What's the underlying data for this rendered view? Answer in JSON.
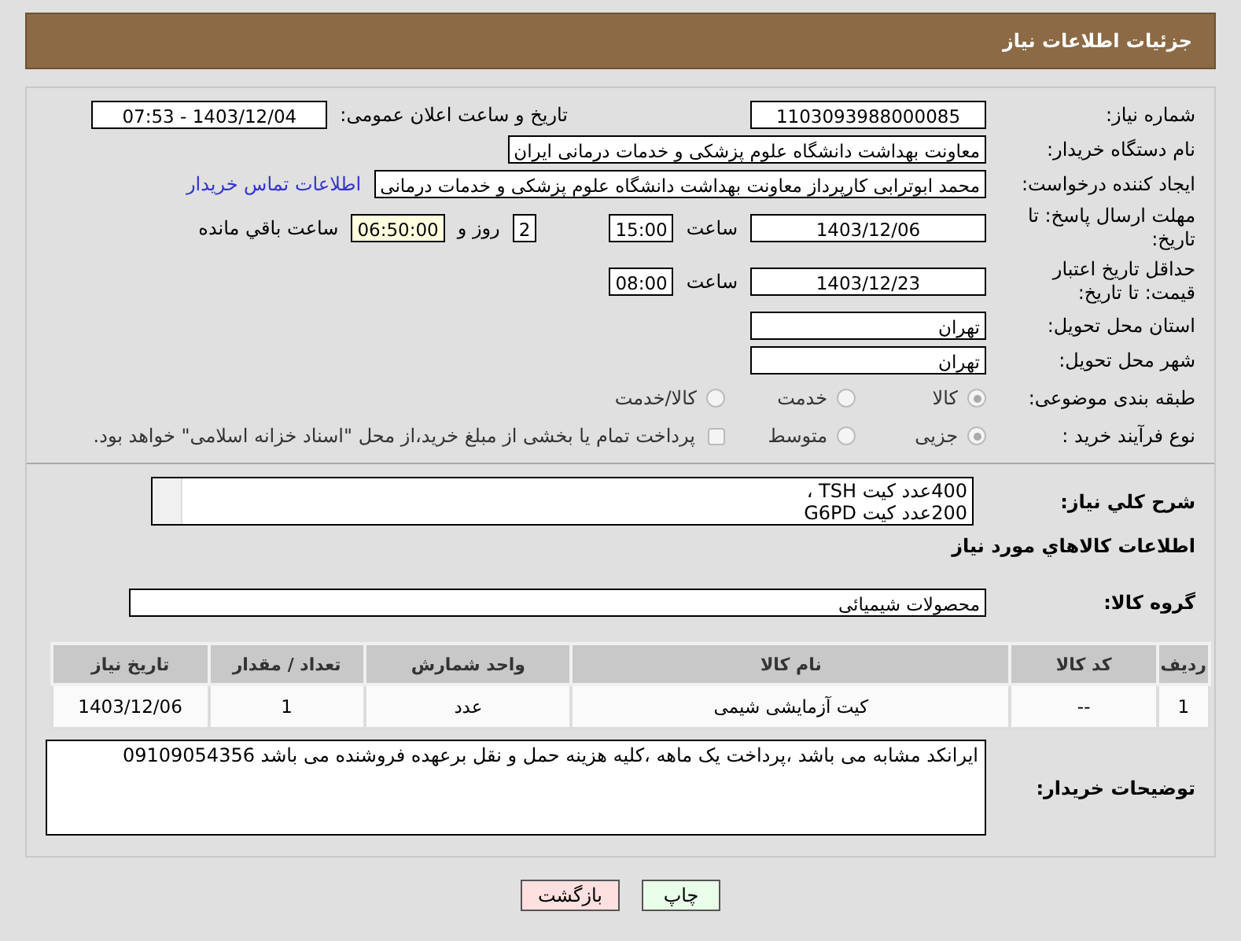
{
  "header": {
    "title": "جزئیات اطلاعات نیاز"
  },
  "need_number": {
    "label": "شماره نیاز:",
    "value": "1103093988000085"
  },
  "announce": {
    "label": "تاریخ و ساعت اعلان عمومی:",
    "value": "1403/12/04 - 07:53"
  },
  "buyer_org": {
    "label": "نام دستگاه خریدار:",
    "value": "معاونت بهداشت دانشگاه علوم پزشکی و خدمات درمانی ایران"
  },
  "creator": {
    "label": "ایجاد کننده درخواست:",
    "value": "محمد ابوترابی کارپرداز معاونت بهداشت دانشگاه علوم پزشکی و خدمات درمانی",
    "link": "اطلاعات تماس خریدار"
  },
  "deadline": {
    "label": "مهلت ارسال پاسخ: تا تاریخ:",
    "date": "1403/12/06",
    "time_label": "ساعت",
    "time": "15:00",
    "days": "2",
    "days_label": "روز و",
    "remaining": "06:50:00",
    "remaining_label": "ساعت باقي مانده"
  },
  "price_validity": {
    "label": "حداقل تاریخ اعتبار قیمت: تا تاریخ:",
    "date": "1403/12/23",
    "time_label": "ساعت",
    "time": "08:00"
  },
  "province": {
    "label": "استان محل تحویل:",
    "value": "تهران"
  },
  "city": {
    "label": "شهر محل تحویل:",
    "value": "تهران"
  },
  "category": {
    "label": "طبقه بندی موضوعی:",
    "options": [
      {
        "label": "کالا",
        "selected": true
      },
      {
        "label": "خدمت",
        "selected": false
      },
      {
        "label": "کالا/خدمت",
        "selected": false
      }
    ]
  },
  "process": {
    "label": "نوع فرآیند خرید :",
    "options": [
      {
        "label": "جزیی",
        "selected": true
      },
      {
        "label": "متوسط",
        "selected": false
      }
    ],
    "payment": {
      "checked": false,
      "label": "پرداخت تمام یا بخشی از مبلغ خرید،از محل \"اسناد خزانه اسلامی\" خواهد بود."
    }
  },
  "description": {
    "label": "شرح کلي نياز:",
    "lines": [
      "400عدد کیت TSH ،",
      "200عدد کیت G6PD"
    ]
  },
  "goods_section": {
    "title": "اطلاعات کالاهاي مورد نياز"
  },
  "goods_group": {
    "label": "گروه کالا:",
    "value": "محصولات شیمیائی"
  },
  "table": {
    "columns": [
      "رديف",
      "کد کالا",
      "نام کالا",
      "واحد شمارش",
      "تعداد / مقدار",
      "تاریخ نیاز"
    ],
    "rows": [
      [
        "1",
        "--",
        "کیت آزمایشی شیمی",
        "عدد",
        "1",
        "1403/12/06"
      ]
    ]
  },
  "buyer_notes": {
    "label": "توضیحات خریدار:",
    "value": "ایرانکد مشابه می باشد ،پرداخت یک ماهه ،کلیه هزینه حمل و نقل برعهده فروشنده می باشد 09109054356"
  },
  "buttons": [
    {
      "label": "چاپ",
      "kind": "print"
    },
    {
      "label": "بازگشت",
      "kind": "back"
    }
  ]
}
